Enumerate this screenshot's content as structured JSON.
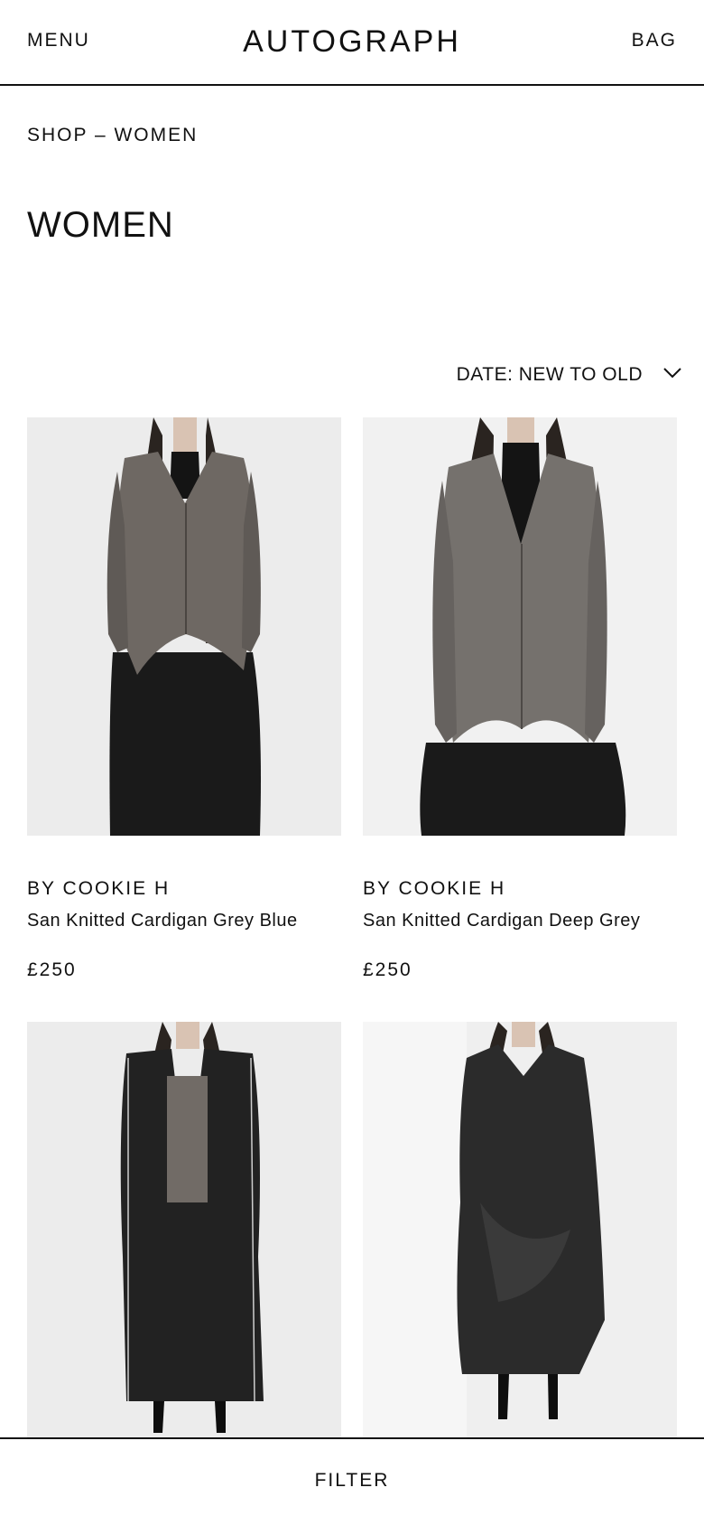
{
  "header": {
    "menu_label": "MENU",
    "logo": "AUTOGRAPH",
    "bag_label": "BAG"
  },
  "breadcrumb": "SHOP – WOMEN",
  "page_title": "WOMEN",
  "sort": {
    "label": "DATE: NEW TO OLD",
    "icon": "chevron-down-icon"
  },
  "products": [
    {
      "brand": "BY COOKIE H",
      "name": "San Knitted Cardigan Grey Blue",
      "price": "£250"
    },
    {
      "brand": "BY COOKIE H",
      "name": "San Knitted Cardigan Deep Grey",
      "price": "£250"
    },
    {},
    {}
  ],
  "filter_label": "FILTER",
  "colors": {
    "text": "#111111",
    "background": "#ffffff",
    "image_background": "#f0f0f0"
  }
}
